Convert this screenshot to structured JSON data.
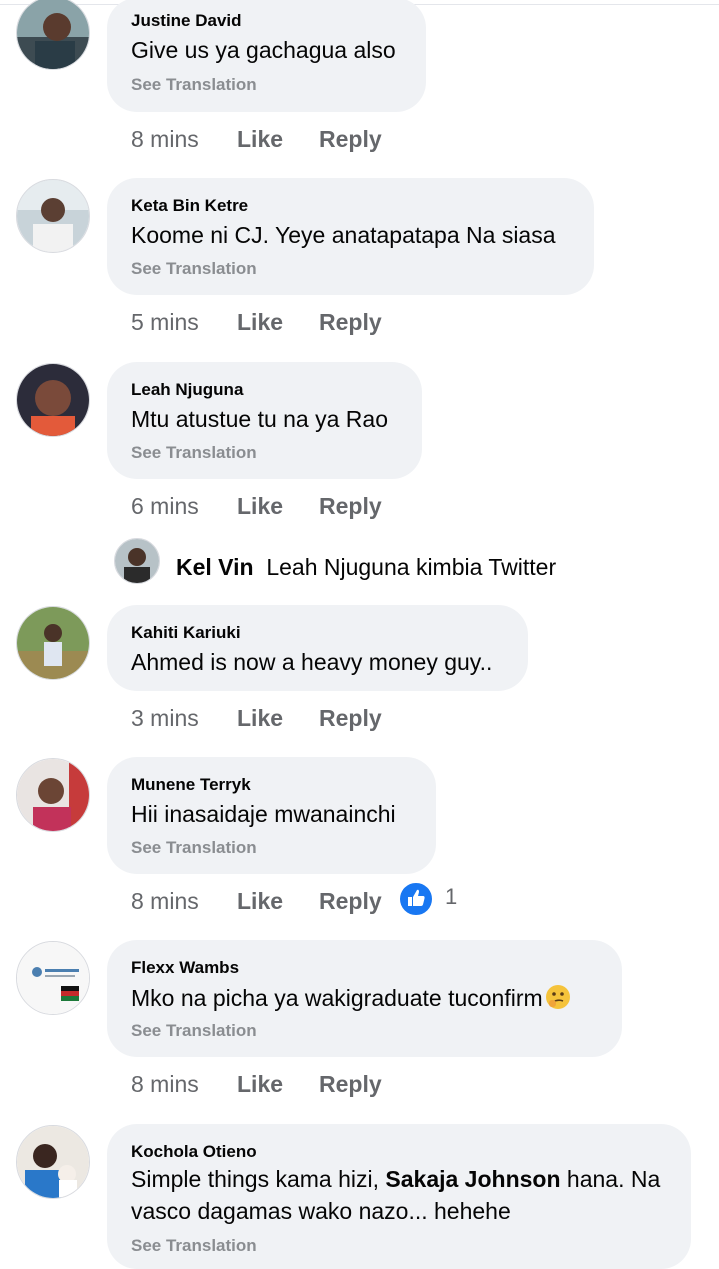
{
  "comments": [
    {
      "author": "Justine David",
      "text": "Give us ya gachagua also",
      "translate": "See Translation",
      "time": "8 mins",
      "like": "Like",
      "reply": "Reply"
    },
    {
      "author": "Keta Bin Ketre",
      "text": "Koome ni CJ. Yeye anatapatapa Na siasa",
      "translate": "See Translation",
      "time": "5 mins",
      "like": "Like",
      "reply": "Reply"
    },
    {
      "author": "Leah Njuguna",
      "text": "Mtu atustue tu na ya Rao",
      "translate": "See Translation",
      "time": "6 mins",
      "like": "Like",
      "reply": "Reply"
    },
    {
      "author": "Kahiti Kariuki",
      "text": "Ahmed is now a heavy money guy..",
      "time": "3 mins",
      "like": "Like",
      "reply": "Reply"
    },
    {
      "author": "Munene Terryk",
      "text": "Hii inasaidaje mwanainchi",
      "translate": "See Translation",
      "time": "8 mins",
      "like": "Like",
      "reply": "Reply",
      "reaction_icon": "thumbs-up-icon",
      "reaction_count": "1"
    },
    {
      "author": "Flexx Wambs",
      "text": "Mko na picha ya wakigraduate tuconfirm",
      "emoji": "thinking-face-icon",
      "translate": "See Translation",
      "time": "8 mins",
      "like": "Like",
      "reply": "Reply"
    },
    {
      "author": "Kochola Otieno",
      "text_line1_a": "Simple things kama hizi, ",
      "text_line1_b": "Sakaja Johnson",
      "text_line1_c": " hana. Na",
      "text_line2": "vasco dagamas wako nazo... hehehe",
      "translate": "See Translation"
    }
  ],
  "nested_reply": {
    "author": "Kel Vin",
    "text": "Leah Njuguna kimbia Twitter"
  },
  "colors": {
    "bubble": "#f0f2f5",
    "meta": "#65676b",
    "translate": "#8a8d91",
    "like_blue": "#1877f2"
  }
}
